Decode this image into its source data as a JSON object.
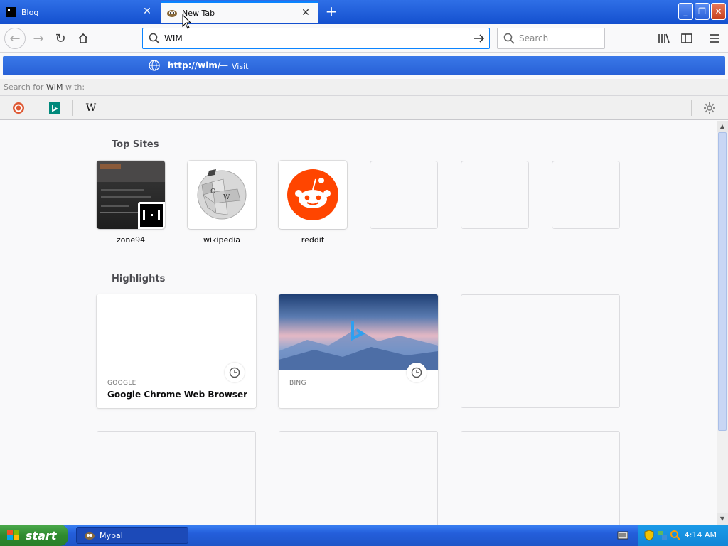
{
  "tabs": [
    {
      "title": "Blog",
      "active": false
    },
    {
      "title": "New Tab",
      "active": true
    }
  ],
  "navbar": {
    "url_value": "WIM",
    "search_placeholder": "Search"
  },
  "suggestion": {
    "url": "http://wim/",
    "dash": "—",
    "action": "Visit"
  },
  "search_with": {
    "prefix": "Search for ",
    "term": "WIM",
    "suffix": " with:"
  },
  "engines": [
    "duckduckgo-icon",
    "bing-icon",
    "wikipedia-icon"
  ],
  "top_sites": {
    "title": "Top Sites",
    "items": [
      {
        "label": "zone94"
      },
      {
        "label": "wikipedia"
      },
      {
        "label": "reddit"
      }
    ]
  },
  "highlights": {
    "title": "Highlights",
    "items": [
      {
        "source": "GOOGLE",
        "title": "Google Chrome Web Browser"
      },
      {
        "source": "BING",
        "title": ""
      }
    ]
  },
  "taskbar": {
    "start_label": "start",
    "task_label": "Mypal",
    "clock": "4:14 AM"
  },
  "colors": {
    "accent": "#0a84ff",
    "taskbar_blue": "#245edb",
    "start_green": "#2f8a2f",
    "reddit": "#ff4500"
  }
}
